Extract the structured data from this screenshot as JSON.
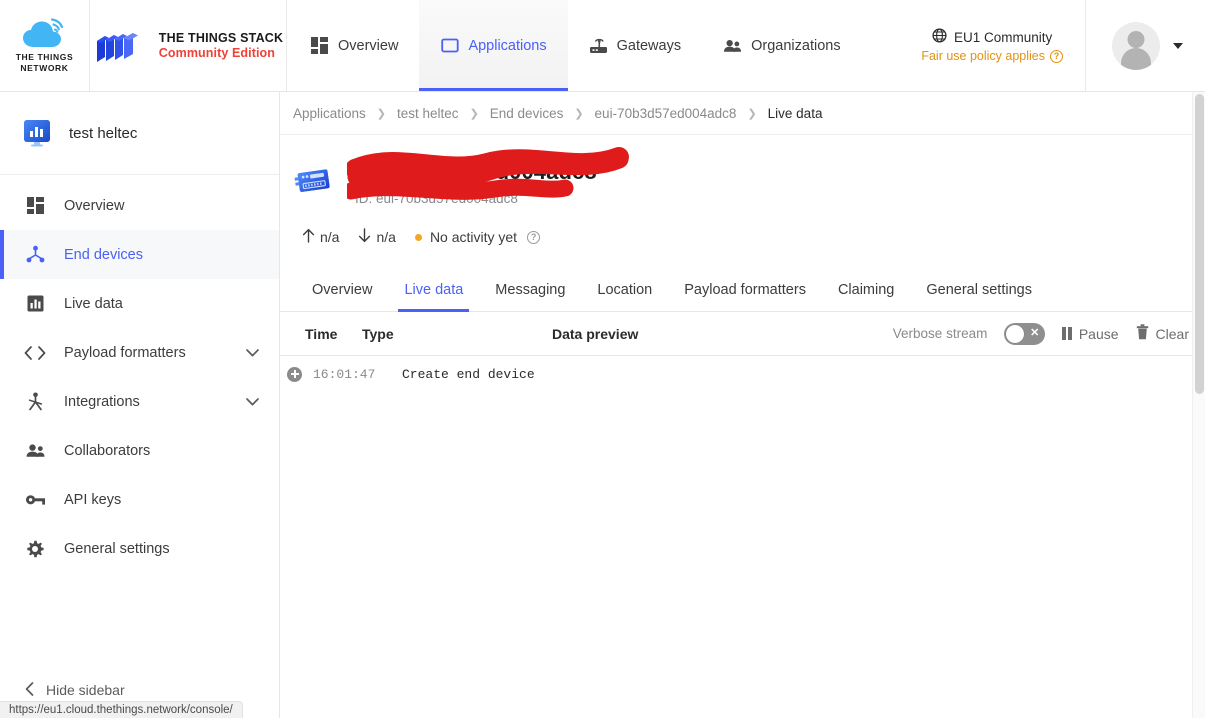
{
  "header": {
    "ttn_logo_text": "THE THINGS\nNETWORK",
    "ttn_logo_line1": "THE THINGS",
    "ttn_logo_line2": "NETWORK",
    "stack_line1": "THE THINGS STACK",
    "stack_line2": "Community Edition",
    "nav": [
      {
        "label": "Overview",
        "icon": "grid-icon",
        "active": false
      },
      {
        "label": "Applications",
        "icon": "application-square-icon",
        "active": true
      },
      {
        "label": "Gateways",
        "icon": "gateway-router-icon",
        "active": false
      },
      {
        "label": "Organizations",
        "icon": "people-group-icon",
        "active": false
      }
    ],
    "cluster_name": "EU1 Community",
    "fair_use": "Fair use policy applies",
    "fair_use_help": "?",
    "accent": "#4a60f7",
    "warning_color": "#e09212"
  },
  "sidebar": {
    "app_name": "test heltec",
    "items": [
      {
        "label": "Overview",
        "icon": "grid-icon",
        "active": false,
        "expandable": false
      },
      {
        "label": "End devices",
        "icon": "end-device-node-icon",
        "active": true,
        "expandable": false
      },
      {
        "label": "Live data",
        "icon": "bar-chart-icon",
        "active": false,
        "expandable": false
      },
      {
        "label": "Payload formatters",
        "icon": "code-brackets-icon",
        "active": false,
        "expandable": true
      },
      {
        "label": "Integrations",
        "icon": "integration-icon",
        "active": false,
        "expandable": true
      },
      {
        "label": "Collaborators",
        "icon": "people-group-icon",
        "active": false,
        "expandable": false
      },
      {
        "label": "API keys",
        "icon": "key-icon",
        "active": false,
        "expandable": false
      },
      {
        "label": "General settings",
        "icon": "gear-icon",
        "active": false,
        "expandable": false
      }
    ],
    "hide_label": "Hide sidebar"
  },
  "breadcrumb": [
    "Applications",
    "test heltec",
    "End devices",
    "eui-70b3d57ed004adc8",
    "Live data"
  ],
  "device": {
    "name_redacted": "eui-70b3d57ed004adc8",
    "id_redacted": "ID: eui-70b3d57ed004adc8",
    "uplink": "n/a",
    "downlink": "n/a",
    "activity": "No activity yet",
    "activity_help": "?"
  },
  "tabs": [
    {
      "label": "Overview",
      "active": false
    },
    {
      "label": "Live data",
      "active": true
    },
    {
      "label": "Messaging",
      "active": false
    },
    {
      "label": "Location",
      "active": false
    },
    {
      "label": "Payload formatters",
      "active": false
    },
    {
      "label": "Claiming",
      "active": false
    },
    {
      "label": "General settings",
      "active": false
    }
  ],
  "table": {
    "columns": {
      "time": "Time",
      "type": "Type",
      "preview": "Data preview"
    },
    "verbose_label": "Verbose stream",
    "verbose_on": false,
    "pause_label": "Pause",
    "clear_label": "Clear",
    "rows": [
      {
        "time": "16:01:47",
        "type": "Create end device",
        "preview": ""
      }
    ]
  },
  "status_bar": {
    "url": "https://eu1.cloud.thethings.network/console/"
  }
}
